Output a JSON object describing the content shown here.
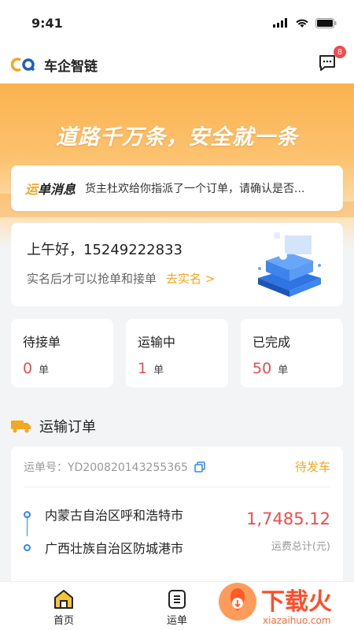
{
  "status_bar": {
    "time": "9:41"
  },
  "header": {
    "app_name": "车企智链",
    "message_badge": "8"
  },
  "banner": {
    "slogan": "道路千万条，安全就一条"
  },
  "notice": {
    "title_prefix": "运",
    "title_rest": "单消息",
    "text": "货主杜欢给你指派了一个订单，请确认是否..."
  },
  "greeting": {
    "hello": "上午好，15249222833",
    "hint": "实名后才可以抢单和接单",
    "link": "去实名 >"
  },
  "stats": [
    {
      "label": "待接单",
      "value": "0",
      "unit": "单"
    },
    {
      "label": "运输中",
      "value": "1",
      "unit": "单"
    },
    {
      "label": "已完成",
      "value": "50",
      "unit": "单"
    }
  ],
  "section": {
    "title": "运输订单"
  },
  "order": {
    "number": "运单号：YD200820143255365",
    "status": "待发车",
    "from": "内蒙古自治区呼和浩特市",
    "to": "广西壮族自治区防城港市",
    "amount": "1,7485.12",
    "amount_label": "运费总计(元)"
  },
  "tabbar": {
    "home": "首页",
    "waybill": "运单"
  },
  "watermark": {
    "text": "下载火",
    "url": "xiazaihuo.com"
  },
  "colors": {
    "accent": "#f5a623",
    "danger": "#f04b4b",
    "route": "#2f86f6"
  }
}
